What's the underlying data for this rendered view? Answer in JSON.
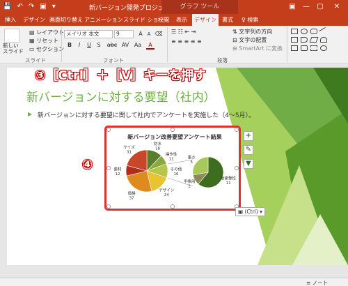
{
  "window": {
    "doc_title": "新バージョン開発プロジェクト概要.pptx",
    "tools_label": "グラフ ツール",
    "qat_icons": [
      "save-icon",
      "undo-icon",
      "redo-icon",
      "start-from-beginning-icon"
    ],
    "minimize": "—",
    "restore": "▢",
    "close": "✕"
  },
  "tabs": [
    {
      "label": "挿入"
    },
    {
      "label": "デザイン"
    },
    {
      "label": "画面切り替え"
    },
    {
      "label": "アニメーション"
    },
    {
      "label": "スライド ショー"
    },
    {
      "label": "校閲"
    },
    {
      "label": "表示"
    },
    {
      "label": "デザイン"
    },
    {
      "label": "書式"
    },
    {
      "label": "検索"
    }
  ],
  "ribbon": {
    "new_slide": "新しい\nスライド",
    "layout": "レイアウト",
    "reset": "リセット",
    "section": "セクション",
    "slides_group": "スライド",
    "font_name": "メイリオ 本文",
    "font_size": "9",
    "font_group": "フォント",
    "paragraph_group": "段落",
    "text_direction": "文字列の方向",
    "text_align": "文字の配置",
    "smartart": "SmartArt に変換",
    "format_buttons": [
      "B",
      "I",
      "U",
      "S",
      "abc",
      "AV",
      "Aa",
      "A"
    ]
  },
  "slide": {
    "title": "新バージョンに対する要望（社内）",
    "bullet": "新バージョンに対する要望に関して社内でアンケートを実施した（4～5月）。"
  },
  "annotations": {
    "step3": "③［Ctrl］＋［V］キーを押す",
    "step4": "④"
  },
  "chart_data": {
    "type": "pie",
    "title": "新バージョン改善要望アンケート結果",
    "categories": [
      "防水",
      "操作性",
      "その他",
      "デザイン",
      "価格",
      "素材",
      "サイズ"
    ],
    "values": [
      18,
      11,
      16,
      24,
      37,
      12,
      31
    ],
    "colors": [
      "#5a7d2a",
      "#8aa93c",
      "#b5c64a",
      "#e8c334",
      "#dd8a1e",
      "#b32b1c",
      "#c8472b"
    ],
    "secondary": {
      "categories": [
        "耐衝撃性",
        "手帳用",
        "重さ"
      ],
      "values": [
        11,
        2,
        5
      ],
      "colors": [
        "#3f6d1f",
        "#8d8b5a",
        "#a7c85a"
      ]
    },
    "labels": {
      "防水": "防水\n18",
      "操作性": "操作性\n11",
      "その他": "その他\n16",
      "デザイン": "デザイン\n24",
      "価格": "価格\n37",
      "素材": "素材\n12",
      "サイズ": "サイズ\n31",
      "耐衝撃性": "耐衝撃性\n11",
      "手帳用": "手帳用\n2",
      "重さ": "重さ\n5"
    }
  },
  "chart_side": {
    "add_element": "+",
    "style": "brush-icon",
    "filter": "filter-icon"
  },
  "paste_options": "(Ctrl) ▾",
  "status": {
    "notes": "ノート"
  }
}
